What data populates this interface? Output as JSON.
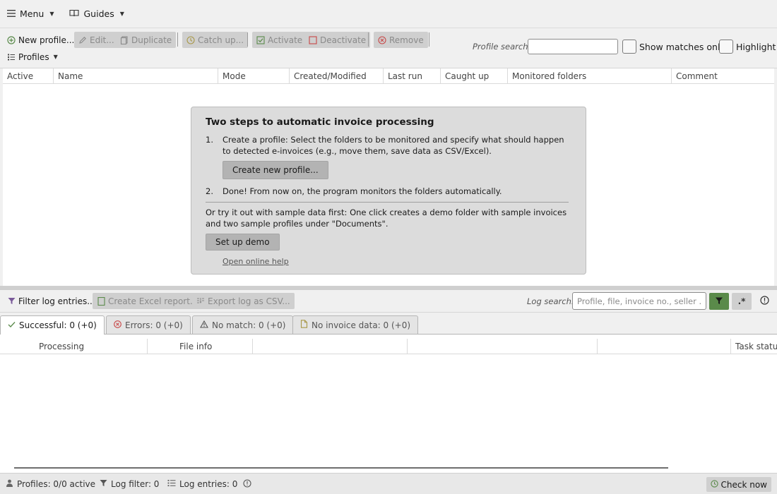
{
  "menubar": {
    "menu_label": "Menu",
    "guides_label": "Guides"
  },
  "toolbar": {
    "new_profile": "New profile...",
    "edit": "Edit...",
    "duplicate": "Duplicate",
    "catch_up": "Catch up...",
    "activate": "Activate",
    "deactivate": "Deactivate",
    "remove": "Remove",
    "profiles_menu": "Profiles",
    "profile_search_label": "Profile search:",
    "profile_search_value": "",
    "show_matches_only": "Show matches only",
    "highlight": "Highlight"
  },
  "profiles_table": {
    "columns": [
      "Active",
      "Name",
      "Mode",
      "Created/Modified",
      "Last run",
      "Caught up",
      "Monitored folders",
      "Comment"
    ]
  },
  "onboarding": {
    "title": "Two steps to automatic invoice processing",
    "step1_num": "1.",
    "step1_text": "Create a profile: Select the folders to be monitored and specify what should happen to detected e-invoices (e.g., move them, save data as CSV/Excel).",
    "create_button": "Create new profile...",
    "step2_num": "2.",
    "step2_text": "Done! From now on, the program monitors the folders automatically.",
    "demo_text": "Or try it out with sample data first: One click creates a demo folder with sample invoices and two sample profiles under \"Documents\".",
    "demo_button": "Set up demo",
    "help_link": "Open online help"
  },
  "logbar": {
    "filter": "Filter log entries...",
    "excel_report": "Create Excel report...",
    "export_csv": "Export log as CSV...",
    "log_search_label": "Log search:",
    "log_search_placeholder": "Profile, file, invoice no., seller ..",
    "regex_label": ".*"
  },
  "log_tabs": [
    {
      "label": "Successful: 0  (+0)",
      "icon": "check-icon"
    },
    {
      "label": "Errors: 0  (+0)",
      "icon": "error-circle-icon"
    },
    {
      "label": "No match: 0  (+0)",
      "icon": "warning-icon"
    },
    {
      "label": "No invoice data: 0  (+0)",
      "icon": "document-icon"
    }
  ],
  "log_table": {
    "columns": [
      "Processing",
      "File info",
      "",
      "",
      "Task status"
    ]
  },
  "statusbar": {
    "profiles": "Profiles: 0/0 active",
    "log_filter": "Log filter: 0",
    "log_entries": "Log entries: 0",
    "check_now": "Check now"
  },
  "colors": {
    "accent_green": "#5a8a4a",
    "disabled_bg": "#cfcfcf",
    "error_red": "#c84848",
    "filter_purple": "#7a5a9a"
  }
}
